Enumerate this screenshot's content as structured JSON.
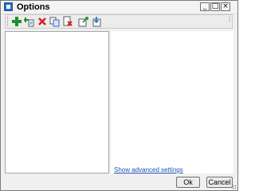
{
  "window": {
    "title": "Options",
    "icon": "options-window-icon"
  },
  "titlebar_buttons": {
    "minimize": "_",
    "maximize": "□",
    "close": "×"
  },
  "toolbar": {
    "icons": [
      "add-icon",
      "add-item-icon",
      "delete-icon",
      "copy-icon",
      "remove-icon",
      "export-icon",
      "import-icon"
    ],
    "overflow": "⋮"
  },
  "advanced_link": "Show advanced settings",
  "buttons": {
    "ok": "Ok",
    "cancel": "Cancel"
  },
  "colors": {
    "link": "#1f4fb8",
    "add_green": "#1e8f2e",
    "delete_red": "#d42020",
    "accent_blue": "#2b6cc4"
  }
}
